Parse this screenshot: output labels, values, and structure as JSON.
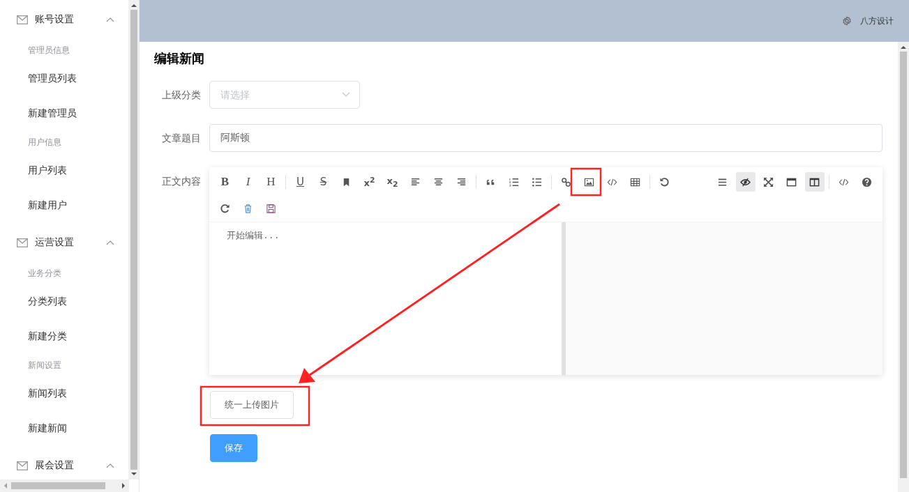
{
  "sidebar": {
    "groups": [
      {
        "title": "账号设置",
        "expanded": true,
        "sections": [
          {
            "label": "管理员信息",
            "items": [
              "管理员列表",
              "新建管理员"
            ]
          },
          {
            "label": "用户信息",
            "items": [
              "用户列表",
              "新建用户"
            ]
          }
        ]
      },
      {
        "title": "运营设置",
        "expanded": true,
        "sections": [
          {
            "label": "业务分类",
            "items": [
              "分类列表",
              "新建分类"
            ]
          },
          {
            "label": "新闻设置",
            "items": [
              "新闻列表",
              "新建新闻"
            ]
          }
        ]
      },
      {
        "title": "展会设置",
        "expanded": true
      }
    ]
  },
  "header": {
    "user": "八方设计"
  },
  "page_title": "编辑新闻",
  "form": {
    "category": {
      "label": "上级分类",
      "placeholder": "请选择"
    },
    "title": {
      "label": "文章题目",
      "value": "阿斯顿"
    },
    "content": {
      "label": "正文内容",
      "placeholder": "开始编辑...",
      "toolbar_rows": [
        [
          {
            "kind": "bold",
            "label": "B",
            "active": false
          },
          {
            "kind": "italic",
            "label": "I",
            "active": false
          },
          {
            "kind": "heading",
            "label": "H",
            "active": false
          },
          {
            "kind": "separator"
          },
          {
            "kind": "underline",
            "label": "U",
            "active": false
          },
          {
            "kind": "strike",
            "label": "S",
            "active": false
          },
          {
            "kind": "bookmark",
            "active": false
          },
          {
            "kind": "sup",
            "label": "x$^{2}$",
            "active": false
          },
          {
            "kind": "sub",
            "label": "x$_{2}$",
            "active": false
          },
          {
            "kind": "align-left",
            "active": false
          },
          {
            "kind": "align-center",
            "active": false
          },
          {
            "kind": "align-right",
            "active": false
          },
          {
            "kind": "separator"
          },
          {
            "kind": "quote",
            "active": false
          },
          {
            "kind": "ordered-list",
            "active": false
          },
          {
            "kind": "bullet-list",
            "active": false
          },
          {
            "kind": "separator"
          },
          {
            "kind": "link",
            "active": false
          },
          {
            "kind": "image",
            "active": false
          },
          {
            "kind": "code",
            "active": false
          },
          {
            "kind": "table",
            "active": false
          },
          {
            "kind": "separator"
          },
          {
            "kind": "undo",
            "active": false
          },
          {
            "kind": "spacer"
          },
          {
            "kind": "menu",
            "active": false
          },
          {
            "kind": "preview",
            "active": true
          },
          {
            "kind": "fullscreen",
            "active": false
          },
          {
            "kind": "window",
            "active": false
          },
          {
            "kind": "split",
            "active": true
          },
          {
            "kind": "separator"
          },
          {
            "kind": "code",
            "active": false
          },
          {
            "kind": "help",
            "active": false
          }
        ],
        [
          {
            "kind": "redo",
            "active": false
          },
          {
            "kind": "trash",
            "active": false
          },
          {
            "kind": "save",
            "active": false
          }
        ]
      ]
    },
    "upload_button": "统一上传图片",
    "save_button": "保存"
  }
}
